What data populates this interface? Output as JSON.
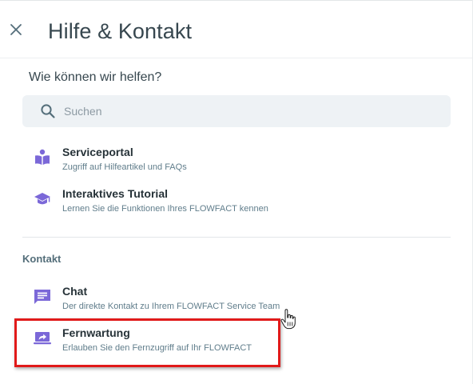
{
  "header": {
    "title": "Hilfe & Kontakt"
  },
  "help": {
    "subtitle": "Wie können wir helfen?",
    "search_placeholder": "Suchen",
    "items": [
      {
        "title": "Serviceportal",
        "description": "Zugriff auf Hilfeartikel und FAQs",
        "icon": "book-reader-icon"
      },
      {
        "title": "Interaktives Tutorial",
        "description": "Lernen Sie die Funktionen Ihres FLOWFACT kennen",
        "icon": "graduation-cap-icon"
      }
    ]
  },
  "contact": {
    "section_label": "Kontakt",
    "items": [
      {
        "title": "Chat",
        "description": "Der direkte Kontakt zu Ihrem FLOWFACT Service Team",
        "icon": "chat-icon"
      },
      {
        "title": "Fernwartung",
        "description": "Erlauben Sie den Fernzugriff auf Ihr FLOWFACT",
        "icon": "remote-screen-share-icon"
      }
    ]
  },
  "colors": {
    "icon_accent": "#7b68d8",
    "highlight_border": "#e11a1a",
    "search_background": "#eef2f5"
  }
}
